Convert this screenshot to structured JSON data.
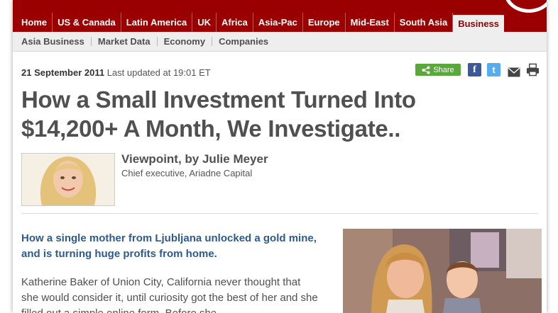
{
  "nav": {
    "main": [
      "Home",
      "US & Canada",
      "Latin America",
      "UK",
      "Africa",
      "Asia-Pac",
      "Europe",
      "Mid-East",
      "South Asia",
      "Business"
    ],
    "active": "Business",
    "sub": [
      "Asia Business",
      "Market Data",
      "Economy",
      "Companies"
    ]
  },
  "article": {
    "date": "21 September 2011",
    "updated": "Last updated at 19:01 ET",
    "share_label": "Share",
    "headline_line1": "How a Small Investment Turned Into",
    "headline_line2": "$14,200+ A Month, We Investigate..",
    "byline": "Viewpoint, by Julie Meyer",
    "role": "Chief executive, Ariadne Capital",
    "intro": "How a single mother from Ljubljana unlocked a gold mine, and is turning huge profits from home.",
    "body": "Katherine Baker of Union City, California never thought that she would consider it, until curiosity got the best of her and she filled out a simple online form. Before she"
  },
  "colors": {
    "brand": "#9b0000",
    "link": "#2e5a8e",
    "share": "#5aa83c",
    "facebook": "#3b5998",
    "twitter": "#55acee"
  },
  "icons": [
    "share-icon",
    "facebook-icon",
    "twitter-icon",
    "email-icon",
    "print-icon"
  ]
}
